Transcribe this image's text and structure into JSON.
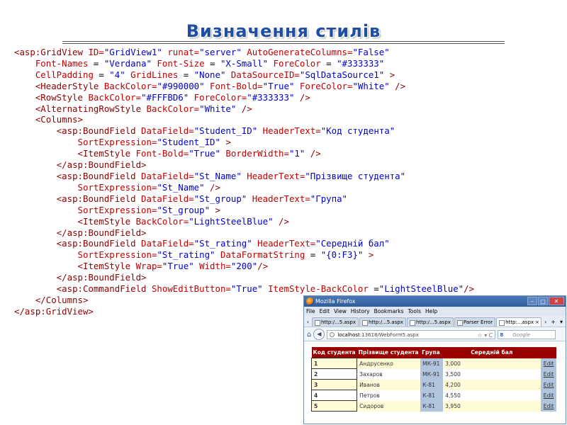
{
  "slide": {
    "title": "Визначення стилів"
  },
  "code_lines": [
    [
      [
        "t",
        "<asp:GridView "
      ],
      [
        "a",
        "ID="
      ],
      [
        "v",
        "\"GridView1\""
      ],
      [
        "a",
        " runat="
      ],
      [
        "v",
        "\"server\""
      ],
      [
        "a",
        " AutoGenerateColumns="
      ],
      [
        "v",
        "\"False\""
      ]
    ],
    [
      [
        "p",
        "    "
      ],
      [
        "a",
        "Font-Names "
      ],
      [
        "p",
        "= "
      ],
      [
        "v",
        "\"Verdana\""
      ],
      [
        "a",
        " Font-Size "
      ],
      [
        "p",
        "= "
      ],
      [
        "v",
        "\"X-Small\""
      ],
      [
        "a",
        " ForeColor "
      ],
      [
        "p",
        "= "
      ],
      [
        "v",
        "\"#333333\""
      ]
    ],
    [
      [
        "p",
        "    "
      ],
      [
        "a",
        "CellPadding "
      ],
      [
        "p",
        "= "
      ],
      [
        "v",
        "\"4\""
      ],
      [
        "a",
        " GridLines "
      ],
      [
        "p",
        "= "
      ],
      [
        "v",
        "\"None\""
      ],
      [
        "a",
        " DataSourceID="
      ],
      [
        "v",
        "\"SqlDataSource1\""
      ],
      [
        "p",
        " "
      ],
      [
        "t",
        ">"
      ]
    ],
    [
      [
        "p",
        "    "
      ],
      [
        "t",
        "<HeaderStyle "
      ],
      [
        "a",
        "BackColor="
      ],
      [
        "v",
        "\"#990000\""
      ],
      [
        "a",
        " Font-Bold="
      ],
      [
        "v",
        "\"True\""
      ],
      [
        "a",
        " ForeColor="
      ],
      [
        "v",
        "\"White\""
      ],
      [
        "t",
        " />"
      ]
    ],
    [
      [
        "p",
        "    "
      ],
      [
        "t",
        "<RowStyle "
      ],
      [
        "a",
        "BackColor="
      ],
      [
        "v",
        "\"#FFFBD6\""
      ],
      [
        "a",
        " ForeColor="
      ],
      [
        "v",
        "\"#333333\""
      ],
      [
        "t",
        " />"
      ]
    ],
    [
      [
        "p",
        "    "
      ],
      [
        "t",
        "<AlternatingRowStyle "
      ],
      [
        "a",
        "BackColor="
      ],
      [
        "v",
        "\"White\""
      ],
      [
        "t",
        " />"
      ]
    ],
    [
      [
        "p",
        "    "
      ],
      [
        "t",
        "<Columns>"
      ]
    ],
    [
      [
        "p",
        "        "
      ],
      [
        "t",
        "<asp:BoundField "
      ],
      [
        "a",
        "DataField="
      ],
      [
        "v",
        "\"Student_ID\""
      ],
      [
        "a",
        " HeaderText="
      ],
      [
        "v",
        "\"Код студента\""
      ]
    ],
    [
      [
        "p",
        "            "
      ],
      [
        "a",
        "SortExpression="
      ],
      [
        "v",
        "\"Student_ID\""
      ],
      [
        "p",
        " "
      ],
      [
        "t",
        ">"
      ]
    ],
    [
      [
        "p",
        "            "
      ],
      [
        "t",
        "<ItemStyle "
      ],
      [
        "a",
        "Font-Bold="
      ],
      [
        "v",
        "\"True\""
      ],
      [
        "a",
        " BorderWidth="
      ],
      [
        "v",
        "\"1\""
      ],
      [
        "t",
        " />"
      ]
    ],
    [
      [
        "p",
        "        "
      ],
      [
        "t",
        "</asp:BoundField>"
      ]
    ],
    [
      [
        "p",
        "        "
      ],
      [
        "t",
        "<asp:BoundField "
      ],
      [
        "a",
        "DataField="
      ],
      [
        "v",
        "\"St_Name\""
      ],
      [
        "a",
        " HeaderText="
      ],
      [
        "v",
        "\"Прізвище студента\""
      ]
    ],
    [
      [
        "p",
        "            "
      ],
      [
        "a",
        "SortExpression="
      ],
      [
        "v",
        "\"St_Name\""
      ],
      [
        "t",
        " />"
      ]
    ],
    [
      [
        "p",
        "        "
      ],
      [
        "t",
        "<asp:BoundField "
      ],
      [
        "a",
        "DataField="
      ],
      [
        "v",
        "\"St_group\""
      ],
      [
        "a",
        " HeaderText="
      ],
      [
        "v",
        "\"Група\""
      ]
    ],
    [
      [
        "p",
        "            "
      ],
      [
        "a",
        "SortExpression="
      ],
      [
        "v",
        "\"St_group\""
      ],
      [
        "p",
        " "
      ],
      [
        "t",
        ">"
      ]
    ],
    [
      [
        "p",
        "            "
      ],
      [
        "t",
        "<ItemStyle "
      ],
      [
        "a",
        "BackColor="
      ],
      [
        "v",
        "\"LightSteelBlue\""
      ],
      [
        "t",
        " />"
      ]
    ],
    [
      [
        "p",
        "        "
      ],
      [
        "t",
        "</asp:BoundField>"
      ]
    ],
    [
      [
        "p",
        "        "
      ],
      [
        "t",
        "<asp:BoundField "
      ],
      [
        "a",
        "DataField="
      ],
      [
        "v",
        "\"St_rating\""
      ],
      [
        "a",
        " HeaderText="
      ],
      [
        "v",
        "\"Середній бал\""
      ]
    ],
    [
      [
        "p",
        "            "
      ],
      [
        "a",
        "SortExpression="
      ],
      [
        "v",
        "\"St_rating\""
      ],
      [
        "a",
        " DataFormatString "
      ],
      [
        "p",
        "= "
      ],
      [
        "v",
        "\"{0:F3}\""
      ],
      [
        "p",
        " "
      ],
      [
        "t",
        ">"
      ]
    ],
    [
      [
        "p",
        "            "
      ],
      [
        "t",
        "<ItemStyle "
      ],
      [
        "a",
        "Wrap="
      ],
      [
        "v",
        "\"True\""
      ],
      [
        "a",
        " Width="
      ],
      [
        "v",
        "\"200\""
      ],
      [
        "t",
        "/>"
      ]
    ],
    [
      [
        "p",
        "        "
      ],
      [
        "t",
        "</asp:BoundField>"
      ]
    ],
    [
      [
        "p",
        "        "
      ],
      [
        "t",
        "<asp:CommandField "
      ],
      [
        "a",
        "ShowEditButton="
      ],
      [
        "v",
        "\"True\""
      ],
      [
        "a",
        " ItemStyle-BackColor "
      ],
      [
        "p",
        "="
      ],
      [
        "v",
        "\"LightSteelBlue\""
      ],
      [
        "t",
        "/>"
      ]
    ],
    [
      [
        "p",
        "    "
      ],
      [
        "t",
        "</Columns>"
      ]
    ],
    [
      [
        "t",
        "</asp:GridView>"
      ]
    ]
  ],
  "colors": {
    "tag": "#8b0000",
    "attribute": "#c00000",
    "value": "#0000cc",
    "header_back": "#990000",
    "row_back": "#FFFBD6",
    "alt_row_back": "#FFFFFF",
    "light_steel_blue": "#B0C4DE"
  },
  "browser": {
    "window_title": "Mozilla Firefox",
    "window_buttons": [
      "–",
      "□",
      "✕"
    ],
    "menu": [
      "File",
      "Edit",
      "View",
      "History",
      "Bookmarks",
      "Tools",
      "Help"
    ],
    "tab_nav_left": "‹",
    "tabs": [
      {
        "label": "http:/...5.aspx",
        "active": false
      },
      {
        "label": "http:/...5.aspx",
        "active": false
      },
      {
        "label": "http:/...5.aspx",
        "active": false
      },
      {
        "label": "Parser Error",
        "active": false
      },
      {
        "label": "http:...aspx",
        "active": true
      }
    ],
    "tab_close": "×",
    "tab_end": [
      "›",
      "+",
      "▾"
    ],
    "url_host": "localhost",
    "url_path": ":13618/WebForm5.aspx",
    "url_status": "☆ ▾ C",
    "search_engine": "8",
    "search_placeholder": "Google",
    "grid": {
      "headers": [
        "Код студента",
        "Прізвище студента",
        "Група",
        "Середній бал",
        ""
      ],
      "rows": [
        {
          "id": "1",
          "name": "Андрусенко",
          "group": "МК-91",
          "rating": "3,000",
          "action": "Edit"
        },
        {
          "id": "2",
          "name": "Захаров",
          "group": "МК-91",
          "rating": "3,500",
          "action": "Edit"
        },
        {
          "id": "3",
          "name": "Иванов",
          "group": "К-81",
          "rating": "4,200",
          "action": "Edit"
        },
        {
          "id": "4",
          "name": "Петров",
          "group": "К-81",
          "rating": "4,550",
          "action": "Edit"
        },
        {
          "id": "5",
          "name": "Сидоров",
          "group": "К-81",
          "rating": "3,950",
          "action": "Edit"
        }
      ]
    }
  }
}
